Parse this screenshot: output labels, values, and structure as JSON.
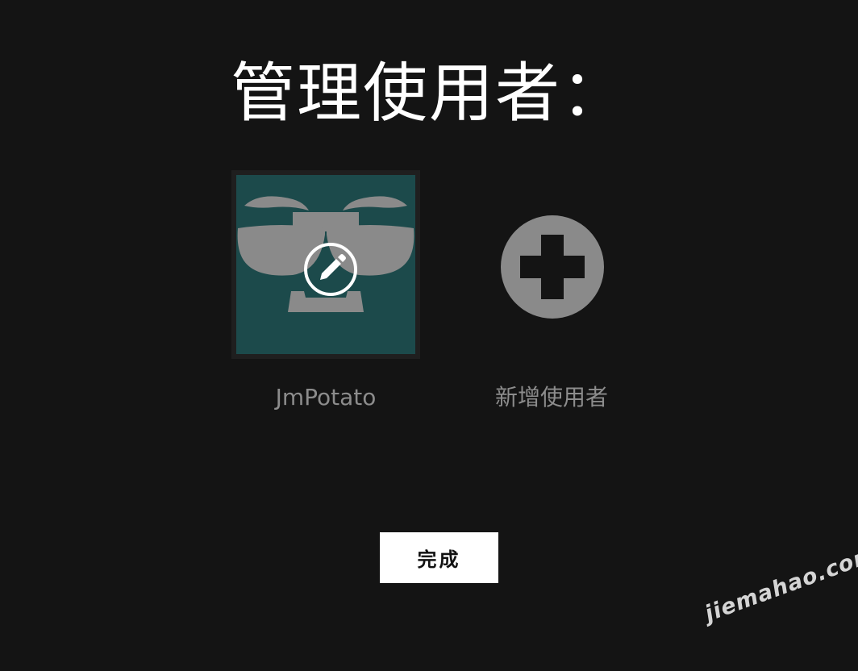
{
  "header": {
    "title": "管理使用者："
  },
  "profiles": [
    {
      "name": "JmPotato",
      "avatar_bg": "#1c4a4b",
      "avatar_fg": "#8a8a8a",
      "edit_icon": "pencil-circle-icon"
    }
  ],
  "add_profile": {
    "label": "新增使用者",
    "icon": "plus-circle-icon",
    "icon_color": "#8a8a8a"
  },
  "actions": {
    "done_label": "完成"
  },
  "watermark": {
    "text": "jiemahao.com"
  },
  "theme": {
    "background": "#141414",
    "title_color": "#ffffff",
    "label_color": "#8c8c8c",
    "button_bg": "#ffffff"
  }
}
